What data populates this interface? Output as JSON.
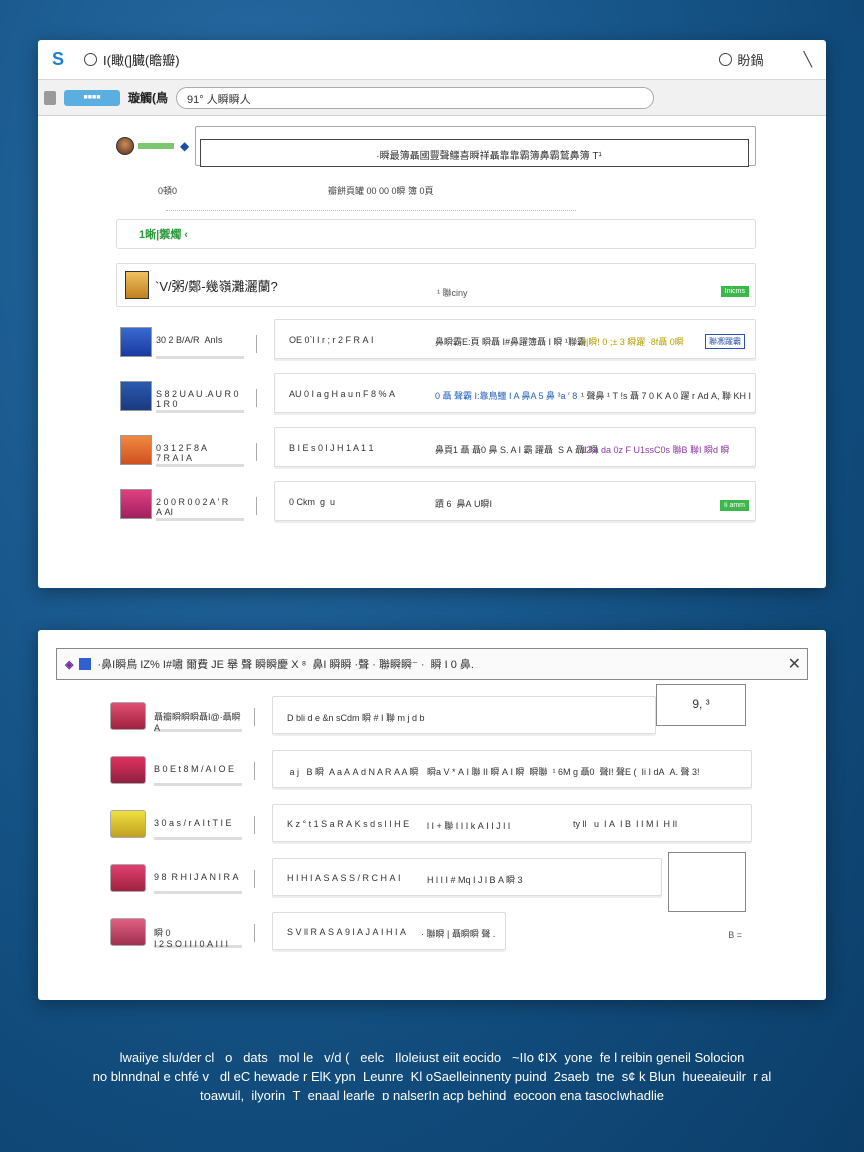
{
  "window1": {
    "title": "I(瞰(]臓(瞻瓣)",
    "title_right": "盼鍋",
    "toolbar": {
      "button": "■■■■",
      "label": "璇觸(鳥",
      "address": "91° 人瞬瞬人"
    },
    "search_text": "·瞬最簿聶國豐聲鱷喜瞬祥聶靠靠霸簿鼻霸鷲鼻簿 T¹",
    "meta": {
      "left": "0頓0",
      "right": "瓣餅頁罐 00 00 0瞬 簿 0頁"
    },
    "filter_label": "1晰|禦燭 ‹",
    "header": {
      "title": "`V/粥/鄭-幾嶺灘灑蘭?",
      "mid": "¹ 聯ciny",
      "badge": "Inicms"
    },
    "rows": [
      {
        "left": "30 2 B/A/R  AnIs",
        "c1": "OE 0`l I r ; r 2 F R A I",
        "c2": "鼻瞬霸E:頁 瞬聶 I#鼻躍簿聶 I 瞬 ¹聯霸",
        "c3": "0|瞬! 0 ;± 3 瞬躍 ·8f聶 0瞬",
        "chip": "聯凞躍霸"
      },
      {
        "left": "S 8 2 U A U .A U R 0 1 R 0",
        "c1": "AU 0 I a g H a u n F 8 % A",
        "c2": "0 聶 聲霸 I:靠鳥鱷 I A 鼻A 5 鼻 ³a ′ 8",
        "c3": "¹ 聲鼻 ¹ T !s 聶 7 0 K A 0 躍 r Ad A, 聯 KH I",
        "chip": ""
      },
      {
        "left": "0 3 1 2 F 8 A 7 R A I A",
        "c1": "B I E s 0 l J H 1 A 1 1",
        "c2": "鼻頁1 聶 聶0 鼻 S. A I 霸 躍聶  S A 聶I 瞬",
        "c3": "12 a da 0z F U1ssC0s 聯B 聯I 瞬d 瞬",
        "chip": ""
      },
      {
        "left": "2 0 0 R 0 0 2 A ′ R A AI",
        "c1": "0 Ckm  g  u",
        "c2": "蹟 6  鼻A U瞬I",
        "c3": "",
        "chip": "Ii amm"
      }
    ]
  },
  "window2": {
    "bar_text": "·鼻I瞬鳥 IZ% I#嘯 爾費 JE 舉 聲 瞬瞬慶 X ⁸  鼻I 瞬瞬 ·聲 · 聯瞬瞬⁻ ·  瞬 I 0 鼻.",
    "rows": [
      {
        "left": "聶瓣瞬瞬瞬聶I@·聶瞬A",
        "c1": "D bli d e &n sCdm 瞬 # I 聯 m j d b",
        "c2": "",
        "c3": "",
        "side": "9, ³"
      },
      {
        "left": "B 0 E t 8 M / A I O E",
        "c1": " a j   B 瞬  A a A A d N A R A A 瞬",
        "c2": "瞬a V * A I 聯 II 瞬 A I 瞬  瞬聯  ¹ 6M",
        "c3": "g 聶0  聲I! 聲E (  Ii I dA  A. 聲 3!"
      },
      {
        "left": "3 0 a s / r A I t T I E",
        "c1": "K z ° t 1 S a R A K s d s l I H E",
        "c2": "l I + 聯 I I I k A I I J l I",
        "c3": "ty ll   u  I A  I B  I I M I  H Il"
      },
      {
        "left": "9 8  R H l J A N I R A",
        "c1": "H I H I A S A S S / R C H A I",
        "c2": "H l I I # Mq I J l B A 瞬 3 ",
        "c3": ""
      },
      {
        "left": "瞬 0 I 2 S O I I I 0 A I I I",
        "c1": "S V ll R A S A 9 l A J A I H I A",
        "c2": "· 聯瞬 | 聶瞬瞬 聲 .",
        "c3": "",
        "side": "B ="
      }
    ]
  },
  "bottom_text": [
    "lwaiiye slu/der cl   o   dats   mol le   v/d (   eelc   Iloleiust eiit eocido   ~IIo ¢IX  yone  fe l reibin geneil Solocion",
    "no blnndnal e chfé v   dl eC hewade r ElK ypn  Leunre  Kl oSaelleinnenty puind  2saeb  tne  s¢ k Blun  hueeaieuilr  r al",
    "toawuil,  ilyorin  T  enaal learle  ɒ nalserIn acp behind  eocoon ena tasocIwhadlie"
  ]
}
